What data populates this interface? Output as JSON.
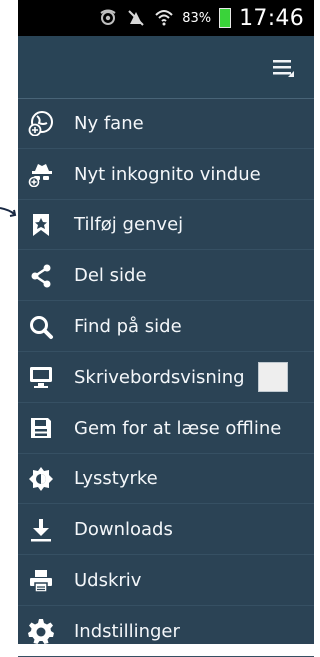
{
  "status_bar": {
    "battery_percent": "83%",
    "time": "17:46",
    "icons": [
      "eye-icon",
      "mute-icon",
      "wifi-icon",
      "battery-icon"
    ]
  },
  "toolbar": {
    "overflow_icon": "menu-icon"
  },
  "menu": {
    "items": [
      {
        "label": "Ny fane",
        "icon": "new-tab-globe-icon"
      },
      {
        "label": "Nyt inkognito vindue",
        "icon": "incognito-icon"
      },
      {
        "label": "Tilføj genvej",
        "icon": "bookmark-icon"
      },
      {
        "label": "Del side",
        "icon": "share-icon"
      },
      {
        "label": "Find på side",
        "icon": "search-icon"
      },
      {
        "label": "Skrivebordsvisning",
        "icon": "desktop-icon",
        "checkbox_checked": false
      },
      {
        "label": "Gem for at læse offline",
        "icon": "save-icon"
      },
      {
        "label": "Lysstyrke",
        "icon": "brightness-icon"
      },
      {
        "label": "Downloads",
        "icon": "download-icon"
      },
      {
        "label": "Udskriv",
        "icon": "print-icon"
      },
      {
        "label": "Indstillinger",
        "icon": "settings-icon"
      }
    ]
  },
  "colors": {
    "panel_background": "#2b4355",
    "text": "#f4f7fa",
    "status_bar": "#000000",
    "battery": "#3ad33a"
  }
}
